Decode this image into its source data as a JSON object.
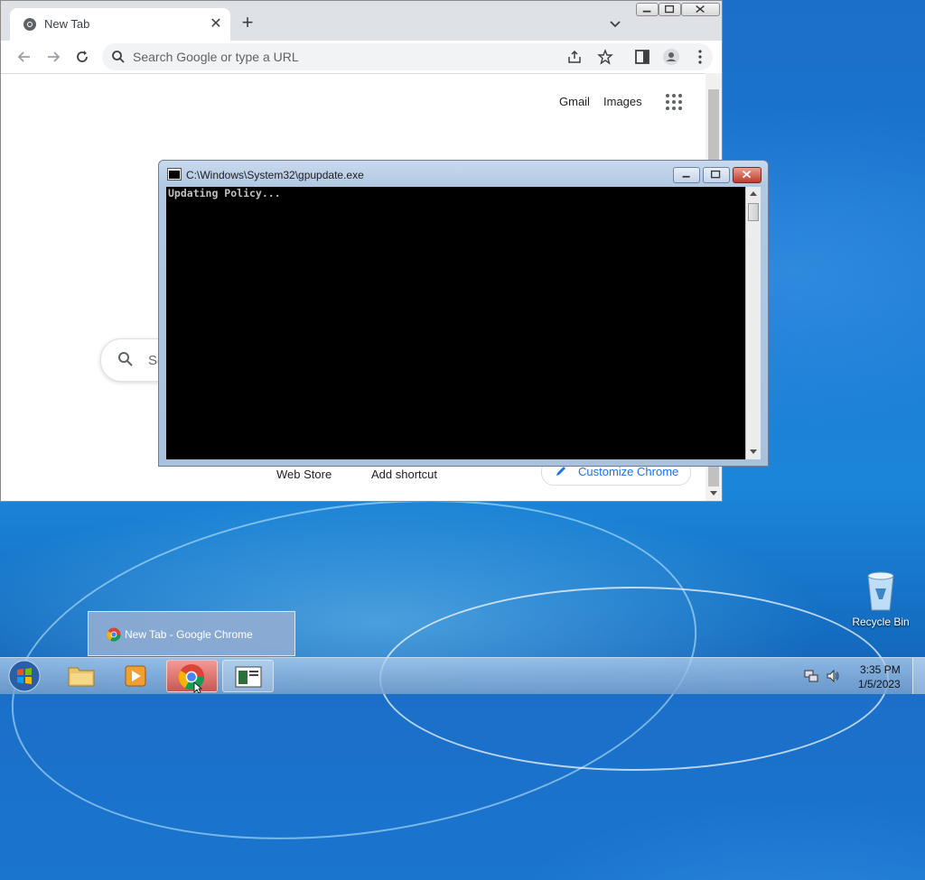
{
  "chrome": {
    "tab_title": "New Tab",
    "omnibox_placeholder": "Search Google or type a URL",
    "links": {
      "gmail": "Gmail",
      "images": "Images"
    },
    "search_box_text": "Se",
    "shortcuts": {
      "web_store": "Web Store",
      "add_shortcut": "Add shortcut"
    },
    "customize_label": "Customize Chrome"
  },
  "console": {
    "title": "C:\\Windows\\System32\\gpupdate.exe",
    "output": "Updating Policy..."
  },
  "taskbar": {
    "preview_label": "New Tab - Google Chrome",
    "time": "3:35 PM",
    "date": "1/5/2023"
  },
  "desktop": {
    "recycle_bin_label": "Recycle Bin"
  },
  "colors": {
    "desktop_blue": "#1b78d2",
    "chrome_tab_strip": "#dee1e6",
    "link_blue": "#1a73e8",
    "console_bg": "#000000"
  }
}
